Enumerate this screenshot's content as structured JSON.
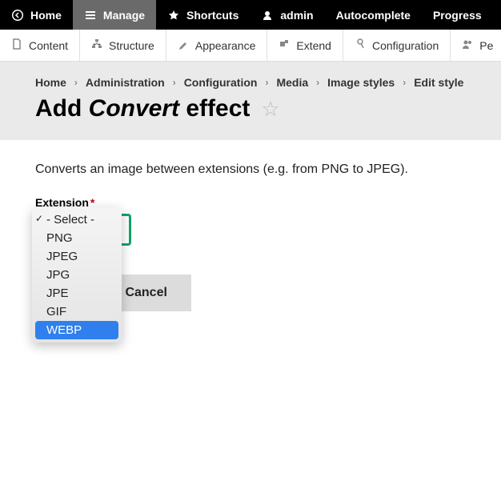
{
  "topbar": {
    "home": "Home",
    "manage": "Manage",
    "shortcuts": "Shortcuts",
    "admin": "admin",
    "autocomplete": "Autocomplete",
    "progress": "Progress"
  },
  "adminbar": {
    "content": "Content",
    "structure": "Structure",
    "appearance": "Appearance",
    "extend": "Extend",
    "configuration": "Configuration",
    "people": "Pe"
  },
  "breadcrumb": [
    "Home",
    "Administration",
    "Configuration",
    "Media",
    "Image styles",
    "Edit style"
  ],
  "title": {
    "add": "Add ",
    "convert": "Convert",
    "effect": " effect"
  },
  "desc": "Converts an image between extensions (e.g. from PNG to JPEG).",
  "field": {
    "label": "Extension"
  },
  "dropdown": {
    "default": "- Select -",
    "options": [
      "PNG",
      "JPEG",
      "JPG",
      "JPE",
      "GIF"
    ],
    "highlighted": "WEBP"
  },
  "buttons": {
    "cancel": "Cancel"
  }
}
